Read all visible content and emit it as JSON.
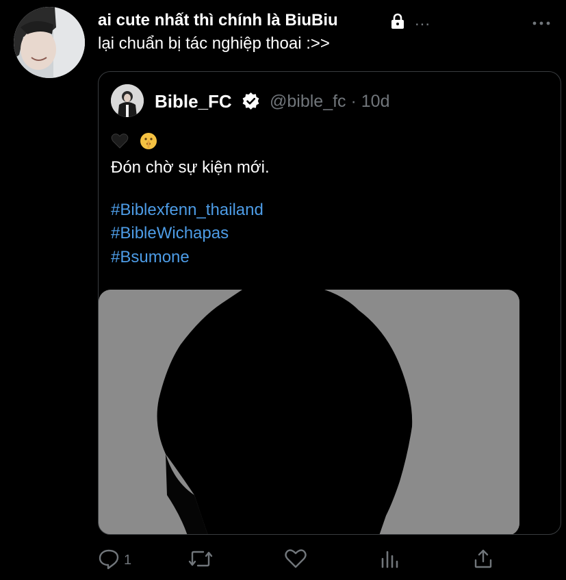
{
  "tweet": {
    "author_name": "ai cute nhất thì chính là BiuBiu",
    "more_label": "...",
    "text": "lại chuẩn bị tác nghiệp thoai :>>"
  },
  "quoted_tweet": {
    "author_name": "Bible_FC",
    "handle_and_time": "@bible_fc · 10d",
    "emojis": [
      "black-heart",
      "shushing-face"
    ],
    "line1": "Đón chờ sự kiện mới.",
    "hashtags": [
      "#Biblexfenn_thailand",
      "#BibleWichapas",
      "#Bsumone"
    ]
  },
  "actions": {
    "reply_count": "1",
    "icons": [
      "reply-icon",
      "retweet-icon",
      "like-icon",
      "analytics-icon",
      "share-icon"
    ]
  },
  "colors": {
    "background": "#000000",
    "text": "#ffffff",
    "secondary": "#71767b",
    "hashtag": "#4d9ce6",
    "border": "#3a3d40"
  }
}
